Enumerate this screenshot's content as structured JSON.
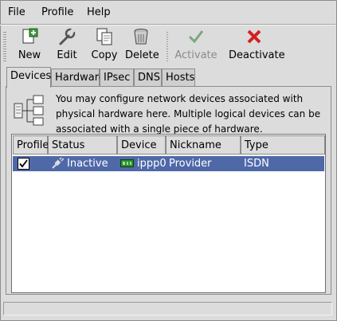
{
  "menu": {
    "file": "File",
    "profile": "Profile",
    "help": "Help"
  },
  "toolbar": {
    "new": "New",
    "edit": "Edit",
    "copy": "Copy",
    "delete": "Delete",
    "activate": "Activate",
    "deactivate": "Deactivate"
  },
  "tabs": [
    "Devices",
    "Hardware",
    "IPsec",
    "DNS",
    "Hosts"
  ],
  "info": {
    "text": "You may configure network devices associated with physical hardware here.  Multiple logical devices can be associated with a single piece of hardware."
  },
  "table": {
    "headers": [
      "Profile",
      "Status",
      "Device",
      "Nickname",
      "Type"
    ],
    "rows": [
      {
        "profile_checked": true,
        "status": "Inactive",
        "device": "ippp0",
        "nickname": "Provider",
        "type": "ISDN"
      }
    ]
  },
  "colors": {
    "selection": "#4f68a8",
    "delete_red": "#d22020",
    "green": "#2d8f2d"
  },
  "statusbar": {
    "text": ""
  }
}
